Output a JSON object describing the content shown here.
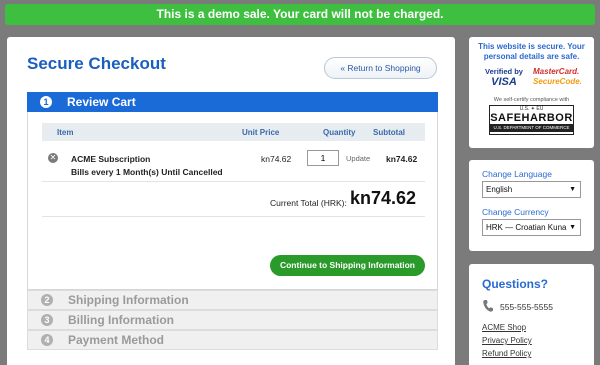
{
  "banner": {
    "text": "This is a demo sale. Your card will not be charged."
  },
  "checkout": {
    "title": "Secure Checkout",
    "return_label": "« Return to Shopping",
    "steps": [
      {
        "num": "1",
        "label": "Review Cart"
      },
      {
        "num": "2",
        "label": "Shipping Information"
      },
      {
        "num": "3",
        "label": "Billing Information"
      },
      {
        "num": "4",
        "label": "Payment Method"
      }
    ],
    "columns": {
      "item": "Item",
      "unit_price": "Unit Price",
      "quantity": "Quantity",
      "subtotal": "Subtotal"
    },
    "item": {
      "name": "ACME Subscription",
      "billing": "Bills every 1 Month(s) Until Cancelled",
      "unit_price": "kn74.62",
      "quantity": "1",
      "update_label": "Update",
      "subtotal": "kn74.62"
    },
    "total_label": "Current Total (HRK):",
    "total_value": "kn74.62",
    "continue_label": "Continue to Shipping Information"
  },
  "security": {
    "text": "This website is secure. Your personal details are safe.",
    "visa_top": "Verified by",
    "visa_main": "VISA",
    "mc_line1": "MasterCard.",
    "mc_line2": "SecureCode.",
    "self_cert": "We self-certify compliance with",
    "sh_top": "U.S. ✦ EU",
    "sh_main": "SAFEHARBOR",
    "sh_bottom": "U.S. DEPARTMENT OF COMMERCE"
  },
  "settings": {
    "language_label": "Change Language",
    "language_value": "English",
    "currency_label": "Change Currency",
    "currency_value": "HRK — Croatian Kuna"
  },
  "help": {
    "title": "Questions?",
    "phone": "555-555-5555",
    "links": [
      "ACME Shop",
      "Privacy Policy",
      "Refund Policy"
    ]
  },
  "icons": {
    "remove": "remove-circle-icon",
    "phone": "phone-icon",
    "dropdown": "chevron-down-icon"
  },
  "colors": {
    "banner": "#3fbf3f",
    "accent": "#1a6ad8",
    "continue": "#2a9a2a"
  }
}
